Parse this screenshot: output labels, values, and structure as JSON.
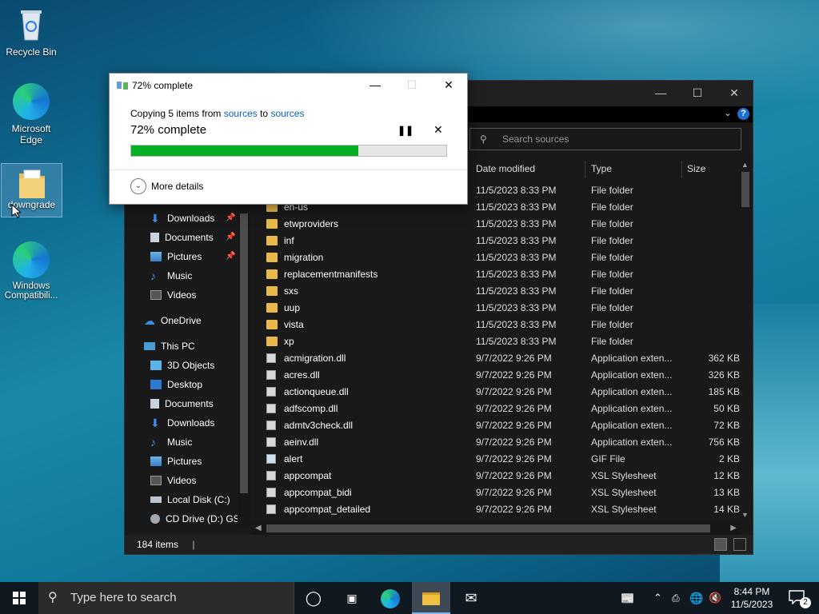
{
  "desktop": {
    "icons": [
      {
        "label": "Recycle Bin"
      },
      {
        "label": "Microsoft Edge"
      },
      {
        "label": "downgrade"
      },
      {
        "label": "Windows Compatibili..."
      }
    ]
  },
  "copy_dialog": {
    "title": "72% complete",
    "copy_prefix": "Copying 5 items from ",
    "source": "sources",
    "copy_to": " to ",
    "destination": "sources",
    "percent_text": "72% complete",
    "progress_fraction": 0.72,
    "more_details": "More details",
    "progress_color": "#06b025"
  },
  "explorer": {
    "search_placeholder": "Search sources",
    "columns": {
      "date": "Date modified",
      "type": "Type",
      "size": "Size"
    },
    "nav": {
      "quick": [
        {
          "label": "Downloads",
          "icon": "download-icon",
          "pinned": true
        },
        {
          "label": "Documents",
          "icon": "documents-icon",
          "pinned": true
        },
        {
          "label": "Pictures",
          "icon": "pictures-icon",
          "pinned": true
        },
        {
          "label": "Music",
          "icon": "music-icon",
          "pinned": false
        },
        {
          "label": "Videos",
          "icon": "videos-icon",
          "pinned": false
        }
      ],
      "onedrive": "OneDrive",
      "thispc": "This PC",
      "pc_items": [
        {
          "label": "3D Objects",
          "icon": "3d-objects-icon"
        },
        {
          "label": "Desktop",
          "icon": "desktop-icon"
        },
        {
          "label": "Documents",
          "icon": "documents-icon"
        },
        {
          "label": "Downloads",
          "icon": "download-icon"
        },
        {
          "label": "Music",
          "icon": "music-icon"
        },
        {
          "label": "Pictures",
          "icon": "pictures-icon"
        },
        {
          "label": "Videos",
          "icon": "videos-icon"
        },
        {
          "label": "Local Disk (C:)",
          "icon": "drive-icon"
        },
        {
          "label": "CD Drive (D:) GS",
          "icon": "cd-drive-icon"
        }
      ]
    },
    "files": [
      {
        "name": "",
        "date": "11/5/2023 8:33 PM",
        "type": "File folder",
        "size": "",
        "kind": "folder"
      },
      {
        "name": "en-us",
        "date": "11/5/2023 8:33 PM",
        "type": "File folder",
        "size": "",
        "kind": "folder"
      },
      {
        "name": "etwproviders",
        "date": "11/5/2023 8:33 PM",
        "type": "File folder",
        "size": "",
        "kind": "folder"
      },
      {
        "name": "inf",
        "date": "11/5/2023 8:33 PM",
        "type": "File folder",
        "size": "",
        "kind": "folder"
      },
      {
        "name": "migration",
        "date": "11/5/2023 8:33 PM",
        "type": "File folder",
        "size": "",
        "kind": "folder"
      },
      {
        "name": "replacementmanifests",
        "date": "11/5/2023 8:33 PM",
        "type": "File folder",
        "size": "",
        "kind": "folder"
      },
      {
        "name": "sxs",
        "date": "11/5/2023 8:33 PM",
        "type": "File folder",
        "size": "",
        "kind": "folder"
      },
      {
        "name": "uup",
        "date": "11/5/2023 8:33 PM",
        "type": "File folder",
        "size": "",
        "kind": "folder"
      },
      {
        "name": "vista",
        "date": "11/5/2023 8:33 PM",
        "type": "File folder",
        "size": "",
        "kind": "folder"
      },
      {
        "name": "xp",
        "date": "11/5/2023 8:33 PM",
        "type": "File folder",
        "size": "",
        "kind": "folder"
      },
      {
        "name": "acmigration.dll",
        "date": "9/7/2022 9:26 PM",
        "type": "Application exten...",
        "size": "362 KB",
        "kind": "dll"
      },
      {
        "name": "acres.dll",
        "date": "9/7/2022 9:26 PM",
        "type": "Application exten...",
        "size": "326 KB",
        "kind": "dll"
      },
      {
        "name": "actionqueue.dll",
        "date": "9/7/2022 9:26 PM",
        "type": "Application exten...",
        "size": "185 KB",
        "kind": "dll"
      },
      {
        "name": "adfscomp.dll",
        "date": "9/7/2022 9:26 PM",
        "type": "Application exten...",
        "size": "50 KB",
        "kind": "dll"
      },
      {
        "name": "admtv3check.dll",
        "date": "9/7/2022 9:26 PM",
        "type": "Application exten...",
        "size": "72 KB",
        "kind": "dll"
      },
      {
        "name": "aeinv.dll",
        "date": "9/7/2022 9:26 PM",
        "type": "Application exten...",
        "size": "756 KB",
        "kind": "dll"
      },
      {
        "name": "alert",
        "date": "9/7/2022 9:26 PM",
        "type": "GIF File",
        "size": "2 KB",
        "kind": "gif"
      },
      {
        "name": "appcompat",
        "date": "9/7/2022 9:26 PM",
        "type": "XSL Stylesheet",
        "size": "12 KB",
        "kind": "xsl"
      },
      {
        "name": "appcompat_bidi",
        "date": "9/7/2022 9:26 PM",
        "type": "XSL Stylesheet",
        "size": "13 KB",
        "kind": "xsl"
      },
      {
        "name": "appcompat_detailed",
        "date": "9/7/2022 9:26 PM",
        "type": "XSL Stylesheet",
        "size": "14 KB",
        "kind": "xsl"
      }
    ],
    "status_count": "184 items",
    "window_title": ""
  },
  "taskbar": {
    "search_placeholder": "Type here to search",
    "time": "8:44 PM",
    "date": "11/5/2023",
    "notification_count": "2"
  }
}
